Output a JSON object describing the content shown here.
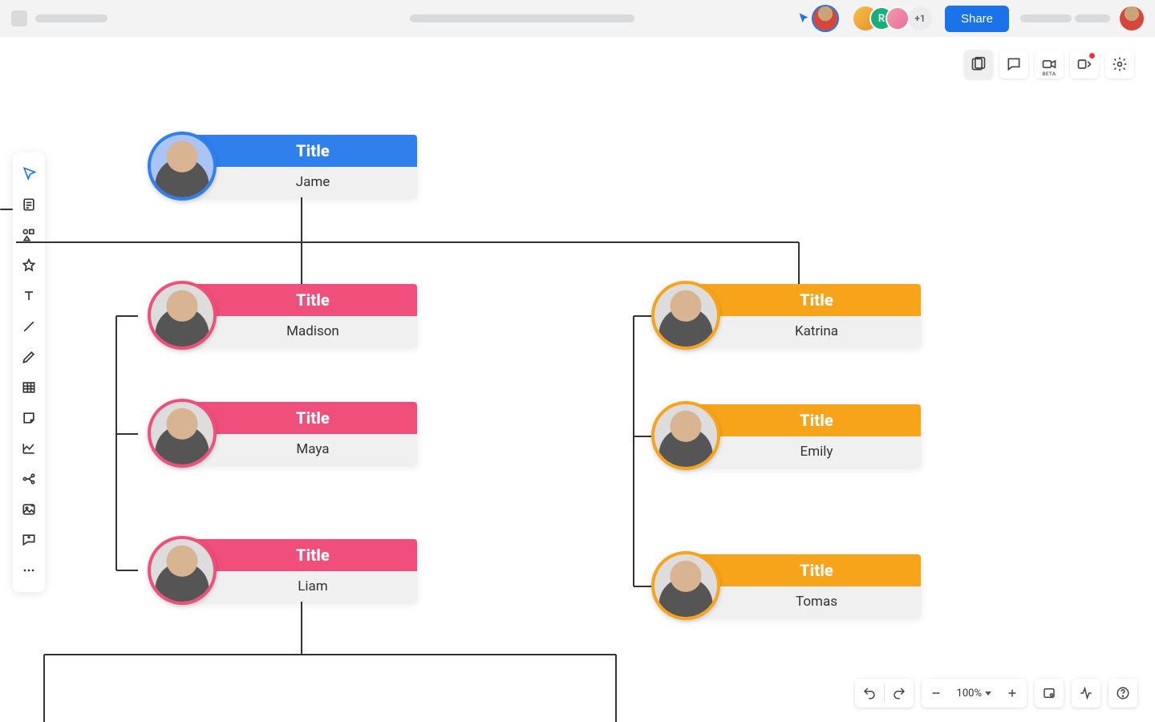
{
  "topbar": {
    "share_label": "Share",
    "presence_count": "+1",
    "presence_avatar_letter": "R"
  },
  "right_toolbar": {
    "beta_label": "BETA"
  },
  "bottombar": {
    "zoom_label": "100%"
  },
  "org": {
    "root": {
      "title": "Title",
      "name": "Jame",
      "color": "blue"
    },
    "left": [
      {
        "title": "Title",
        "name": "Madison",
        "color": "pink"
      },
      {
        "title": "Title",
        "name": "Maya",
        "color": "pink"
      },
      {
        "title": "Title",
        "name": "Liam",
        "color": "pink"
      }
    ],
    "right": [
      {
        "title": "Title",
        "name": "Katrina",
        "color": "orange"
      },
      {
        "title": "Title",
        "name": "Emily",
        "color": "orange"
      },
      {
        "title": "Title",
        "name": "Tomas",
        "color": "orange"
      }
    ]
  }
}
